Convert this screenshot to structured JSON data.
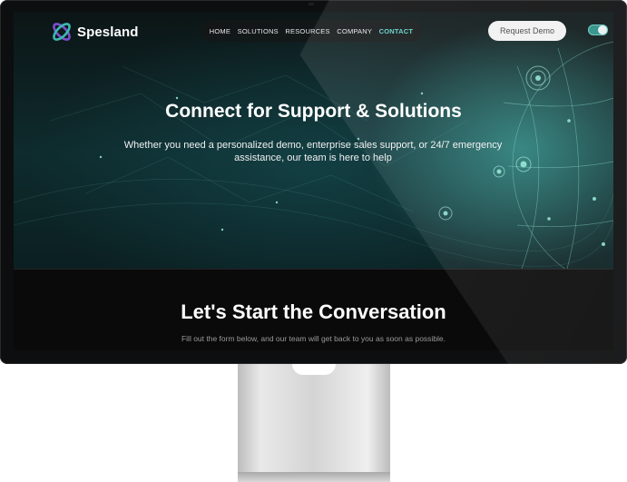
{
  "brand": {
    "name": "Spesland",
    "colors": {
      "accent": "#5fd3c6",
      "logo_primary": "#7b4fd0",
      "logo_secondary": "#3bb8b0"
    }
  },
  "nav": {
    "items": [
      {
        "label": "HOME",
        "active": false
      },
      {
        "label": "SOLUTIONS",
        "active": false
      },
      {
        "label": "RESOURCES",
        "active": false
      },
      {
        "label": "COMPANY",
        "active": false
      },
      {
        "label": "CONTACT",
        "active": true
      }
    ],
    "cta_label": "Request Demo",
    "theme_toggle": {
      "icon": "toggle-switch-icon",
      "on": true
    }
  },
  "hero": {
    "title": "Connect for Support & Solutions",
    "subtitle_line1": "Whether you need a personalized demo, enterprise sales support, or 24/7 emergency",
    "subtitle_line2": "assistance, our team is here to help"
  },
  "section": {
    "title": "Let's Start the Conversation",
    "subtitle": "Fill out the form below, and our team will get back to you as soon as possible."
  }
}
